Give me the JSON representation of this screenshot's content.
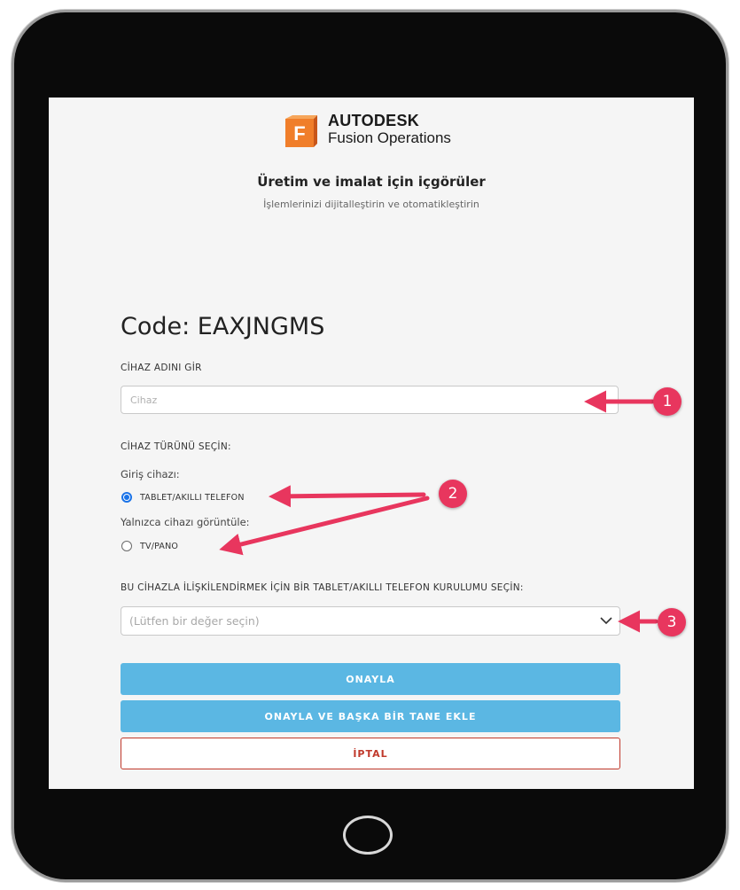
{
  "brand": {
    "logo_letter": "F",
    "company": "AUTODESK",
    "product": "Fusion Operations",
    "colors": {
      "logo_orange": "#f07e2a",
      "logo_dark": "#c8561a"
    }
  },
  "hero": {
    "title": "Üretim ve imalat için içgörüler",
    "subtitle": "İşlemlerinizi dijitalleştirin ve otomatikleştirin"
  },
  "form": {
    "code_text": "Code: EAXJNGMS",
    "device_name_label": "CİHAZ ADINI GİR",
    "device_name_placeholder": "Cihaz",
    "device_name_value": "",
    "device_type_label": "CİHAZ TÜRÜNÜ SEÇİN:",
    "input_device_label": "Giriş cihazı:",
    "option_tablet": "TABLET/AKILLI TELEFON",
    "option_tablet_checked": true,
    "display_only_label": "Yalnızca cihazı görüntüle:",
    "option_tv": "TV/PANO",
    "option_tv_checked": false,
    "setup_label": "BU CİHAZLA İLİŞKİLENDİRMEK İÇİN BİR TABLET/AKILLI TELEFON KURULUMU SEÇİN:",
    "setup_select_placeholder": "(Lütfen bir değer seçin)"
  },
  "buttons": {
    "confirm": "ONAYLA",
    "confirm_add": "ONAYLA VE BAŞKA BİR TANE EKLE",
    "cancel": "İPTAL"
  },
  "annotations": {
    "badge_1": "1",
    "badge_2": "2",
    "badge_3": "3",
    "color": "#e8365e"
  },
  "colors": {
    "primary_button": "#5bb7e3",
    "cancel_border": "#c0392b",
    "radio_selected": "#1a73e8"
  }
}
